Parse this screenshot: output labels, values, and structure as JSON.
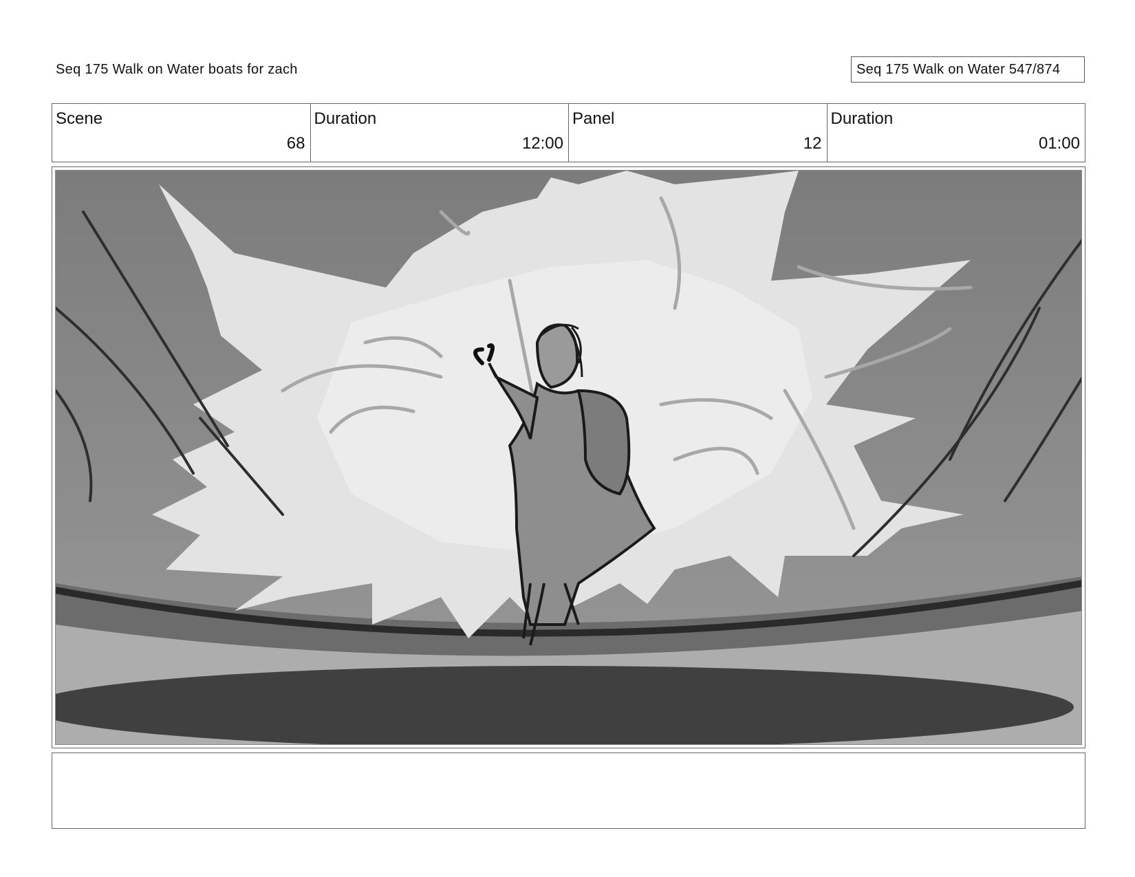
{
  "header": {
    "title_left": "Seq 175 Walk on Water  boats for zach",
    "title_right": "Seq 175 Walk on Water 547/874"
  },
  "info": {
    "scene_label": "Scene",
    "scene_value": "68",
    "scene_duration_label": "Duration",
    "scene_duration_value": "12:00",
    "panel_label": "Panel",
    "panel_value": "12",
    "panel_duration_label": "Duration",
    "panel_duration_value": "01:00"
  },
  "panel": {
    "description_colors": {
      "sky": "#8a8a8a",
      "splash": "#e4e4e4",
      "water": "#6e6e6e",
      "shadow": "#3e3e3e",
      "ink": "#1a1a1a"
    }
  },
  "notes": {
    "text": ""
  }
}
